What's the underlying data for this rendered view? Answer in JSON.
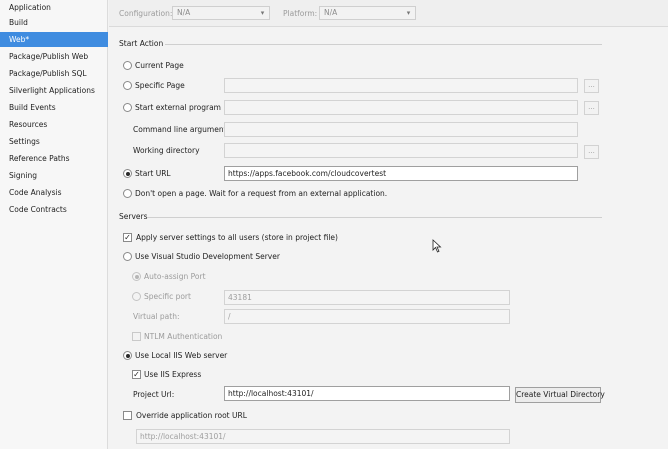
{
  "sidebar": {
    "items": [
      {
        "label": "Application"
      },
      {
        "label": "Build"
      },
      {
        "label": "Web*"
      },
      {
        "label": "Package/Publish Web"
      },
      {
        "label": "Package/Publish SQL"
      },
      {
        "label": "Silverlight Applications"
      },
      {
        "label": "Build Events"
      },
      {
        "label": "Resources"
      },
      {
        "label": "Settings"
      },
      {
        "label": "Reference Paths"
      },
      {
        "label": "Signing"
      },
      {
        "label": "Code Analysis"
      },
      {
        "label": "Code Contracts"
      }
    ],
    "selected_index": 2
  },
  "topbar": {
    "configuration_label": "Configuration:",
    "configuration_value": "N/A",
    "platform_label": "Platform:",
    "platform_value": "N/A"
  },
  "start_action": {
    "title": "Start Action",
    "current_page": "Current Page",
    "specific_page": "Specific Page",
    "start_external_program": "Start external program",
    "command_line_arguments": "Command line arguments",
    "working_directory": "Working directory",
    "start_url": "Start URL",
    "start_url_value": "https://apps.facebook.com/cloudcovertest",
    "dont_open": "Don't open a page.  Wait for a request from an external application.",
    "browse_label": "...",
    "selected": "start_url"
  },
  "servers": {
    "title": "Servers",
    "apply_to_all": "Apply server settings to all users (store in project file)",
    "apply_to_all_checked": true,
    "use_vs_dev_server": "Use Visual Studio Development Server",
    "auto_assign_port": "Auto-assign Port",
    "specific_port": "Specific port",
    "specific_port_value": "43181",
    "virtual_path": "Virtual path:",
    "virtual_path_value": "/",
    "ntlm_auth": "NTLM Authentication",
    "use_local_iis": "Use Local IIS Web server",
    "use_iis_express": "Use IIS Express",
    "use_iis_express_checked": true,
    "project_url_label": "Project Url:",
    "project_url_value": "http://localhost:43101/",
    "create_virtual_directory": "Create Virtual Directory",
    "override_root_url": "Override application root URL",
    "override_root_url_checked": false,
    "override_root_url_value": "http://localhost:43101/",
    "selected": "use_local_iis"
  },
  "colors": {
    "selection": "#3f8ce0",
    "background": "#f3f3f3"
  }
}
